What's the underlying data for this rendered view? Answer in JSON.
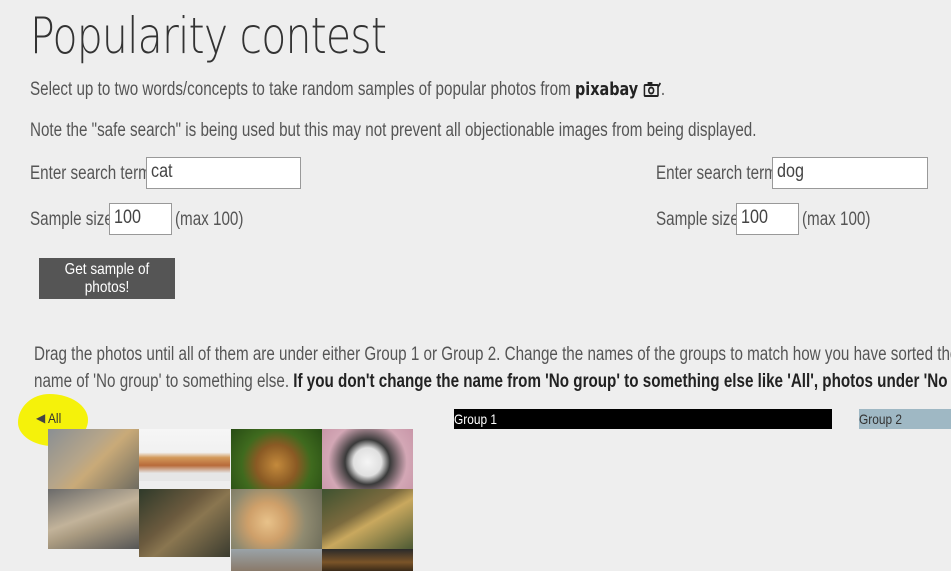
{
  "page": {
    "title": "Popularity contest",
    "intro_line1_prefix": "Select up to two words/concepts to take random samples of popular photos from",
    "intro_logo_text": "pixabay",
    "intro_line1_suffix": ".",
    "intro_line2": "Note the \"safe search\" is being used but this may not prevent all objectionable images from being displayed."
  },
  "search1": {
    "label": "Enter search term:",
    "value": "cat",
    "sample_label": "Sample size:",
    "sample_value": "100",
    "sample_max": "(max 100)"
  },
  "search2": {
    "label": "Enter search term:",
    "value": "dog",
    "sample_label": "Sample size:",
    "sample_value": "100",
    "sample_max": "(max 100)"
  },
  "button": {
    "label": "Get sample of photos!"
  },
  "instructions": {
    "line1": "Drag the photos until all of them are under either Group 1 or Group 2. Change the names of the groups to match how you have sorted the photos. If y",
    "line2_prefix": "name of 'No group' to something else.",
    "line2_bold": "If you don't change the name from 'No group' to something else like 'All', photos under 'No group' will not be"
  },
  "groups": {
    "all_label": "All",
    "group1_label": "Group 1",
    "group2_label": "Group 2"
  },
  "colors": {
    "background": "#eeeeee",
    "button_bg": "#555555",
    "group1_bg": "#000000",
    "group2_bg": "#9fb8c4",
    "highlight": "#f5f20a"
  },
  "photos": [
    {
      "name": "lioness"
    },
    {
      "name": "orange-cat-lying"
    },
    {
      "name": "lion"
    },
    {
      "name": "black-white-cat"
    },
    {
      "name": "lion-cub-resting"
    },
    {
      "name": "lynx"
    },
    {
      "name": "puppy-and-kitten"
    },
    {
      "name": "leopard"
    },
    {
      "name": "cat-partial"
    },
    {
      "name": "cheetah-partial"
    }
  ]
}
